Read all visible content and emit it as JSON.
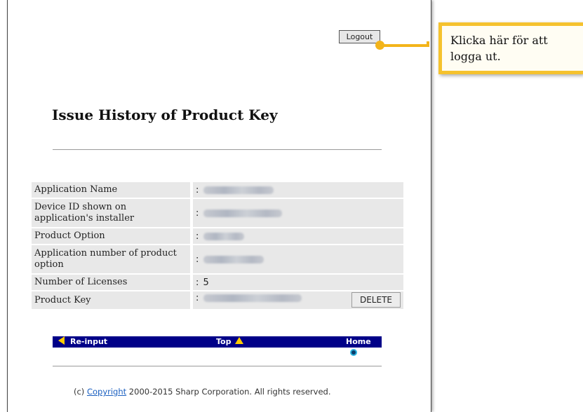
{
  "header": {
    "logout_label": "Logout"
  },
  "callout": {
    "text": "Klicka här för att logga ut."
  },
  "page_title": "Issue History of Product Key",
  "details": [
    {
      "label": "Application Name",
      "value": ":"
    },
    {
      "label": "Device ID shown on application's installer",
      "value": ":"
    },
    {
      "label": "Product Option",
      "value": ":"
    },
    {
      "label": "Application number of product option",
      "value": ":"
    },
    {
      "label": "Number of Licenses",
      "value": ": 5"
    },
    {
      "label": "Product Key",
      "value": ":"
    }
  ],
  "delete_label": "DELETE",
  "nav": {
    "reinput": "Re-input",
    "top": "Top",
    "home": "Home"
  },
  "footer": {
    "prefix": "(c) ",
    "link": "Copyright",
    "suffix": " 2000-2015 Sharp Corporation. All rights reserved."
  },
  "colors": {
    "accent": "#f3b41a",
    "nav_bg": "#000088",
    "row_bg": "#e8e8e8"
  }
}
